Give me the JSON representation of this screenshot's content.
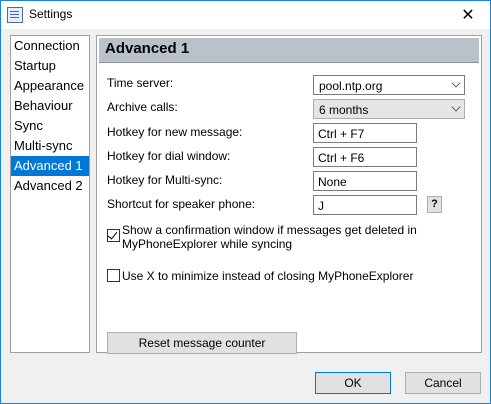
{
  "window": {
    "title": "Settings"
  },
  "nav": {
    "items": [
      {
        "label": "Connection"
      },
      {
        "label": "Startup"
      },
      {
        "label": "Appearance"
      },
      {
        "label": "Behaviour"
      },
      {
        "label": "Sync"
      },
      {
        "label": "Multi-sync"
      },
      {
        "label": "Advanced 1",
        "selected": true
      },
      {
        "label": "Advanced 2"
      }
    ]
  },
  "panel": {
    "title": "Advanced 1",
    "time_server": {
      "label": "Time server:",
      "value": "pool.ntp.org"
    },
    "archive_calls": {
      "label": "Archive calls:",
      "value": "6 months"
    },
    "hotkey_new_message": {
      "label": "Hotkey for new message:",
      "value": "Ctrl + F7"
    },
    "hotkey_dial_window": {
      "label": "Hotkey for dial window:",
      "value": "Ctrl + F6"
    },
    "hotkey_multisync": {
      "label": "Hotkey for Multi-sync:",
      "value": "None"
    },
    "shortcut_speaker": {
      "label": "Shortcut for speaker phone:",
      "value": "J",
      "help_label": "?"
    },
    "confirm_delete": {
      "line1": "Show a confirmation window if messages get deleted in",
      "line2": "MyPhoneExplorer while syncing",
      "checked": true
    },
    "minimize_x": {
      "label": "Use X to minimize instead of closing MyPhoneExplorer",
      "checked": false
    },
    "reset_label": "Reset message counter"
  },
  "footer": {
    "ok_label": "OK",
    "cancel_label": "Cancel"
  }
}
